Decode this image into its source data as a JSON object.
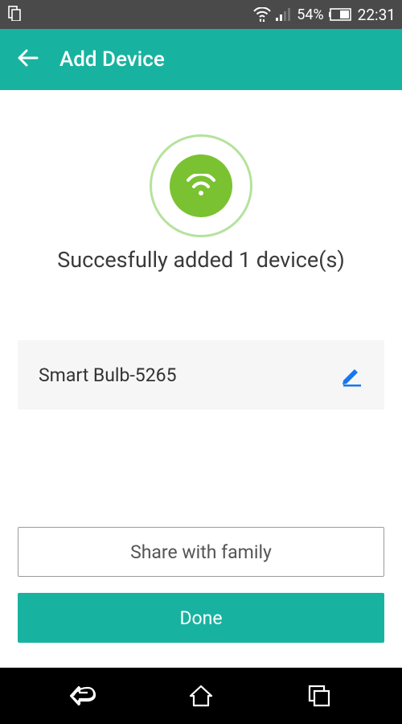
{
  "status_bar": {
    "battery_pct": "54%",
    "clock": "22:31"
  },
  "header": {
    "title": "Add Device"
  },
  "main": {
    "success_message": "Succesfully added 1 device(s)",
    "device": {
      "name": "Smart Bulb-5265"
    },
    "buttons": {
      "share_label": "Share with family",
      "done_label": "Done"
    }
  },
  "colors": {
    "accent": "#18b3a0",
    "success_green": "#7ac231",
    "edit_blue": "#1976f0"
  }
}
